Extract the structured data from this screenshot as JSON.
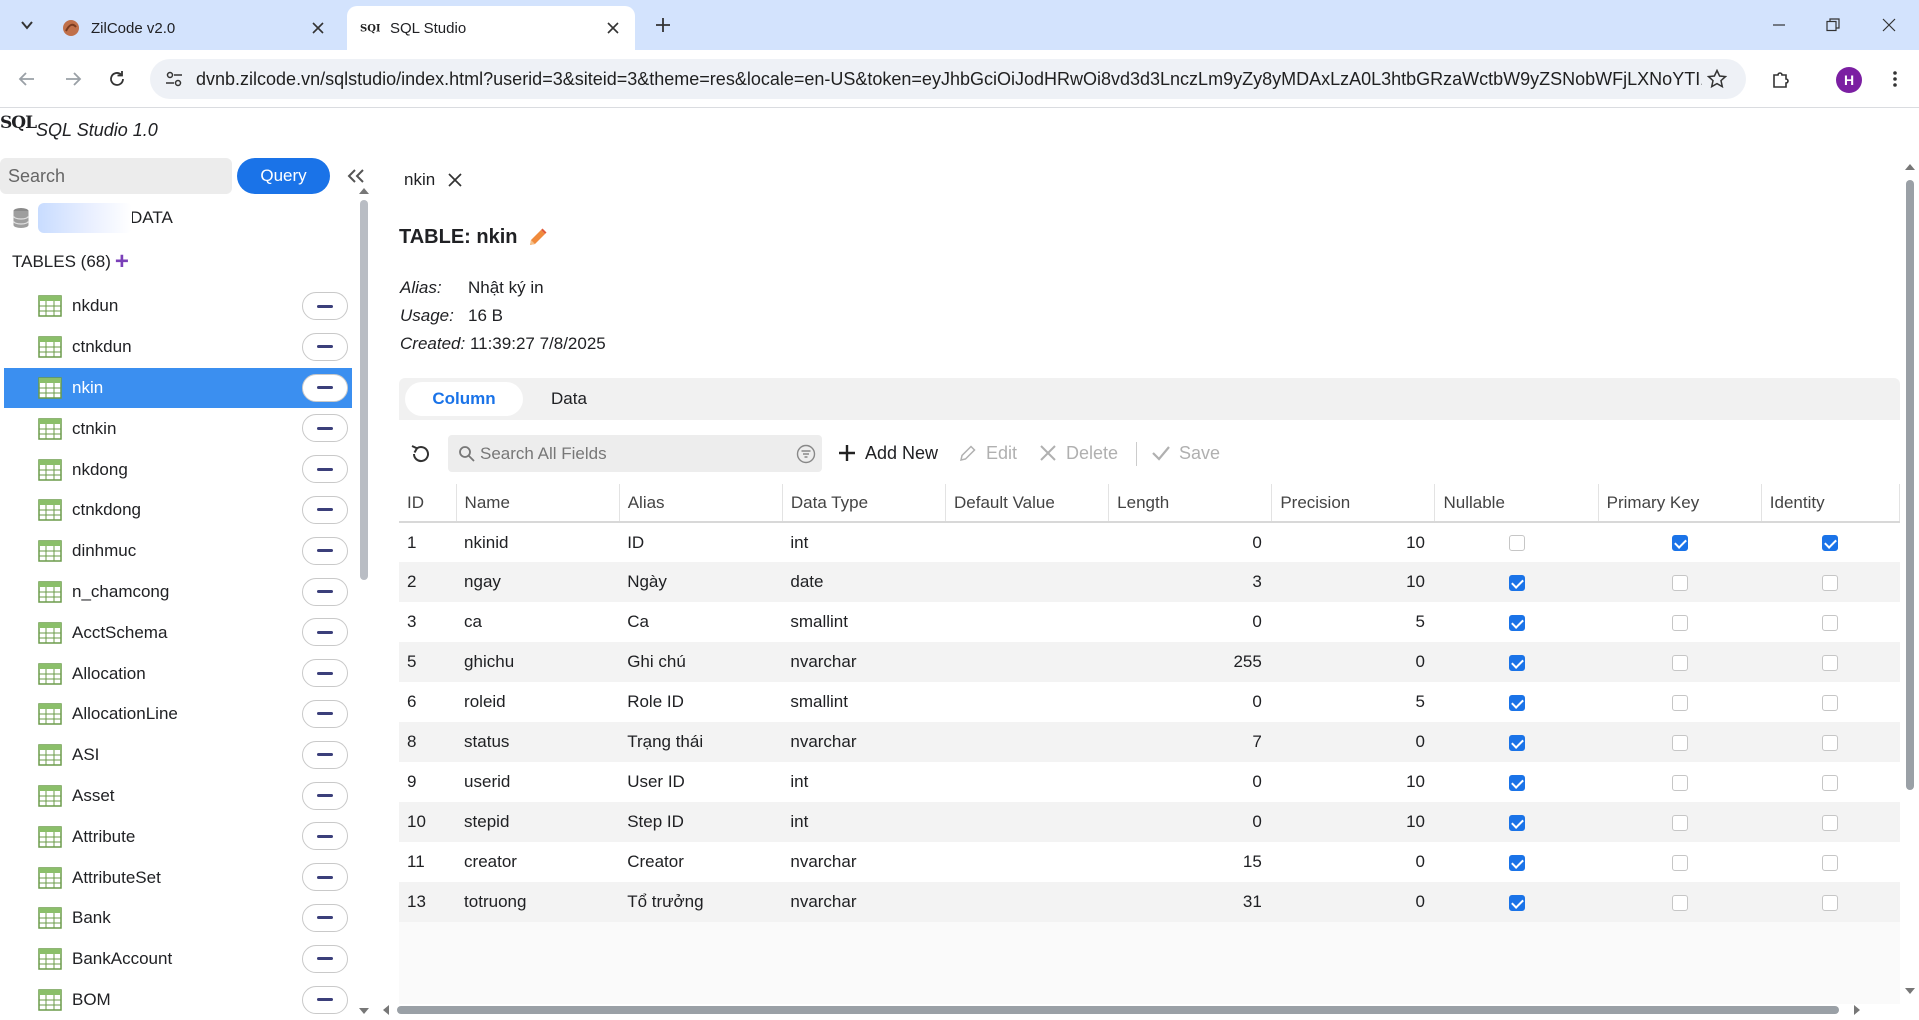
{
  "browser": {
    "tabs": [
      {
        "title": "ZilCode v2.0",
        "favicon": "zilcode-logo-icon",
        "active": false
      },
      {
        "title": "SQL Studio",
        "favicon": "sql-logo-icon",
        "active": true
      }
    ],
    "url": "dvnb.zilcode.vn/sqlstudio/index.html?userid=3&siteid=3&theme=res&locale=en-US&token=eyJhbGciOiJodHRwOi8vd3d3LnczLm9yZy8yMDAxLzA0L3htbGRzaWctbW9yZSNobWFjLXNoYTI1Nil...",
    "profile_initial": "H"
  },
  "app": {
    "logo_text": "SQL",
    "title": "SQL Studio 1.0"
  },
  "sidebar": {
    "search_placeholder": "Search",
    "query_label": "Query",
    "database_suffix": "DATA",
    "tables_header": "TABLES (68)",
    "tables": [
      {
        "label": "nkdun",
        "selected": false
      },
      {
        "label": "ctnkdun",
        "selected": false
      },
      {
        "label": "nkin",
        "selected": true
      },
      {
        "label": "ctnkin",
        "selected": false
      },
      {
        "label": "nkdong",
        "selected": false
      },
      {
        "label": "ctnkdong",
        "selected": false
      },
      {
        "label": "dinhmuc",
        "selected": false
      },
      {
        "label": "n_chamcong",
        "selected": false
      },
      {
        "label": "AcctSchema",
        "selected": false
      },
      {
        "label": "Allocation",
        "selected": false
      },
      {
        "label": "AllocationLine",
        "selected": false
      },
      {
        "label": "ASI",
        "selected": false
      },
      {
        "label": "Asset",
        "selected": false
      },
      {
        "label": "Attribute",
        "selected": false
      },
      {
        "label": "AttributeSet",
        "selected": false
      },
      {
        "label": "Bank",
        "selected": false
      },
      {
        "label": "BankAccount",
        "selected": false
      },
      {
        "label": "BOM",
        "selected": false
      }
    ]
  },
  "main": {
    "open_tab": "nkin",
    "table_title": "TABLE: nkin",
    "meta": {
      "alias_label": "Alias:",
      "alias_value": "Nhật ký in",
      "usage_label": "Usage:",
      "usage_value": "16 B",
      "created_label": "Created:",
      "created_value": "11:39:27 7/8/2025"
    },
    "tabs": [
      {
        "label": "Column",
        "active": true
      },
      {
        "label": "Data",
        "active": false
      }
    ],
    "toolbar": {
      "search_placeholder": "Search All Fields",
      "add_new": "Add New",
      "edit": "Edit",
      "delete": "Delete",
      "save": "Save"
    },
    "grid": {
      "columns": [
        "ID",
        "Name",
        "Alias",
        "Data Type",
        "Default Value",
        "Length",
        "Precision",
        "Nullable",
        "Primary Key",
        "Identity"
      ],
      "rows": [
        {
          "id": "1",
          "name": "nkinid",
          "alias": "ID",
          "type": "int",
          "default": "",
          "length": "0",
          "precision": "10",
          "nullable": false,
          "pk": true,
          "identity": true
        },
        {
          "id": "2",
          "name": "ngay",
          "alias": "Ngày",
          "type": "date",
          "default": "",
          "length": "3",
          "precision": "10",
          "nullable": true,
          "pk": false,
          "identity": false
        },
        {
          "id": "3",
          "name": "ca",
          "alias": "Ca",
          "type": "smallint",
          "default": "",
          "length": "0",
          "precision": "5",
          "nullable": true,
          "pk": false,
          "identity": false
        },
        {
          "id": "5",
          "name": "ghichu",
          "alias": "Ghi chú",
          "type": "nvarchar",
          "default": "",
          "length": "255",
          "precision": "0",
          "nullable": true,
          "pk": false,
          "identity": false
        },
        {
          "id": "6",
          "name": "roleid",
          "alias": "Role ID",
          "type": "smallint",
          "default": "",
          "length": "0",
          "precision": "5",
          "nullable": true,
          "pk": false,
          "identity": false
        },
        {
          "id": "8",
          "name": "status",
          "alias": "Trạng thái",
          "type": "nvarchar",
          "default": "",
          "length": "7",
          "precision": "0",
          "nullable": true,
          "pk": false,
          "identity": false
        },
        {
          "id": "9",
          "name": "userid",
          "alias": "User ID",
          "type": "int",
          "default": "",
          "length": "0",
          "precision": "10",
          "nullable": true,
          "pk": false,
          "identity": false
        },
        {
          "id": "10",
          "name": "stepid",
          "alias": "Step ID",
          "type": "int",
          "default": "",
          "length": "0",
          "precision": "10",
          "nullable": true,
          "pk": false,
          "identity": false
        },
        {
          "id": "11",
          "name": "creator",
          "alias": "Creator",
          "type": "nvarchar",
          "default": "",
          "length": "15",
          "precision": "0",
          "nullable": true,
          "pk": false,
          "identity": false
        },
        {
          "id": "13",
          "name": "totruong",
          "alias": "Tổ trưởng",
          "type": "nvarchar",
          "default": "",
          "length": "31",
          "precision": "0",
          "nullable": true,
          "pk": false,
          "identity": false
        }
      ]
    }
  },
  "colors": {
    "accent": "#1a73e8",
    "selected_row": "#3b8ff0",
    "tabbar": "#d3e3fd",
    "plus": "#7a3fb8"
  }
}
